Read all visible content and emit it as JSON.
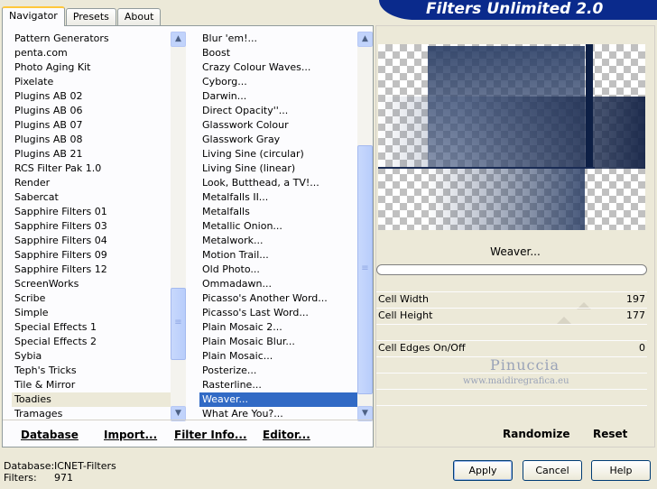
{
  "app": {
    "title": "Filters Unlimited 2.0"
  },
  "tabs": [
    {
      "label": "Navigator",
      "active": true
    },
    {
      "label": "Presets",
      "active": false
    },
    {
      "label": "About",
      "active": false
    }
  ],
  "categories": {
    "items": [
      "Pattern Generators",
      "penta.com",
      "Photo Aging Kit",
      "Pixelate",
      "Plugins AB 02",
      "Plugins AB 06",
      "Plugins AB 07",
      "Plugins AB 08",
      "Plugins AB 21",
      "RCS Filter Pak 1.0",
      "Render",
      "Sabercat",
      "Sapphire Filters 01",
      "Sapphire Filters 03",
      "Sapphire Filters 04",
      "Sapphire Filters 09",
      "Sapphire Filters 12",
      "ScreenWorks",
      "Scribe",
      "Simple",
      "Special Effects 1",
      "Special Effects 2",
      "Sybia",
      "Teph's Tricks",
      "Tile & Mirror",
      "Toadies",
      "Tramages"
    ],
    "selected": "Toadies"
  },
  "filters": {
    "items": [
      "Blur 'em!...",
      "Boost",
      "Crazy Colour Waves...",
      "Cyborg...",
      "Darwin...",
      "Direct Opacity''...",
      "Glasswork Colour",
      "Glasswork Gray",
      "Living Sine (circular)",
      "Living Sine (linear)",
      "Look, Butthead, a TV!...",
      "Metalfalls II...",
      "Metalfalls",
      "Metallic Onion...",
      "Metalwork...",
      "Motion Trail...",
      "Old Photo...",
      "Ommadawn...",
      "Picasso's Another Word...",
      "Picasso's Last Word...",
      "Plain Mosaic 2...",
      "Plain Mosaic Blur...",
      "Plain Mosaic...",
      "Posterize...",
      "Rasterline...",
      "Weaver...",
      "What Are You?..."
    ],
    "selected": "Weaver..."
  },
  "left_toolbar": {
    "database": "Database",
    "import": "Import...",
    "filter_info": "Filter Info...",
    "editor": "Editor..."
  },
  "preview": {
    "filter_name": "Weaver..."
  },
  "params": [
    {
      "label": "Cell Width",
      "value": "197"
    },
    {
      "label": "Cell Height",
      "value": "177"
    },
    {
      "label": "Cell Edges On/Off",
      "value": "0"
    }
  ],
  "watermark": {
    "line1": "Pinuccia",
    "line2": "www.maidiregrafica.eu"
  },
  "right_toolbar": {
    "randomize": "Randomize",
    "reset": "Reset"
  },
  "status": {
    "database_key": "Database:",
    "database_value": "ICNET-Filters",
    "filters_key": "Filters:",
    "filters_value": "971"
  },
  "buttons": {
    "apply": "Apply",
    "cancel": "Cancel",
    "help": "Help"
  },
  "icons": {
    "scroll_up": "chevron-up-icon",
    "scroll_down": "chevron-down-icon"
  }
}
